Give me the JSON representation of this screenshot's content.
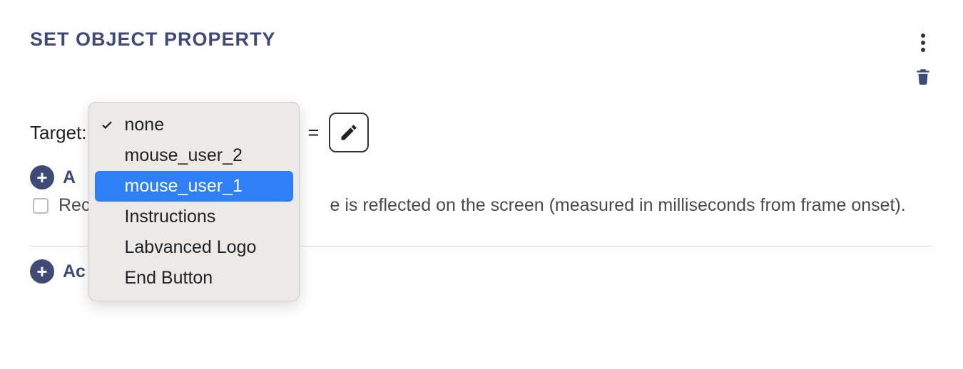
{
  "panel": {
    "title": "SET OBJECT PROPERTY"
  },
  "target": {
    "label": "Target:",
    "equals": "="
  },
  "dropdown": {
    "current": "none",
    "options": [
      "none",
      "mouse_user_2",
      "mouse_user_1",
      "Instructions",
      "Labvanced Logo",
      "End Button"
    ],
    "highlighted_index": 2
  },
  "add_prop": {
    "label": "A"
  },
  "record": {
    "label_visible_prefix": "Rec",
    "label_visible_suffix": "e is reflected on the screen (measured in milliseconds from frame onset)."
  },
  "add_action": {
    "label": "Ac"
  }
}
